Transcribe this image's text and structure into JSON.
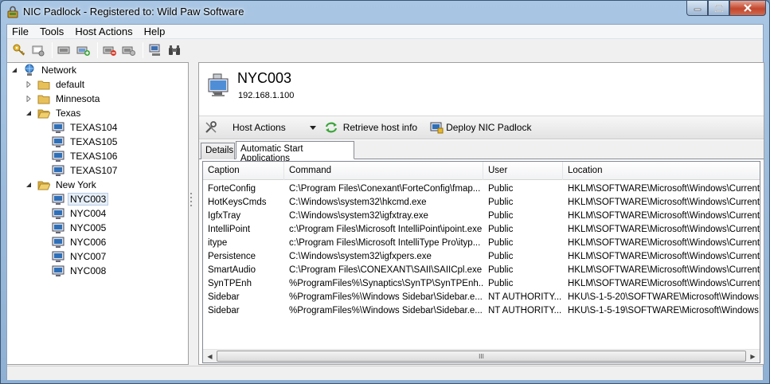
{
  "window": {
    "title": "NIC Padlock - Registered to: Wild Paw Software",
    "controls": [
      "minimize",
      "maximize",
      "close"
    ]
  },
  "menu": [
    "File",
    "Tools",
    "Host Actions",
    "Help"
  ],
  "toolbar": {
    "icons": [
      "key-icon",
      "host-properties-icon",
      "computer-remove-icon",
      "computer-add-icon",
      "computer-lock-icon",
      "computer-unlock-icon",
      "network-scan-icon",
      "binoculars-icon"
    ]
  },
  "tree": {
    "root": "Network",
    "groups": [
      {
        "label": "default",
        "expanded": false,
        "hosts": []
      },
      {
        "label": "Minnesota",
        "expanded": false,
        "hosts": []
      },
      {
        "label": "Texas",
        "expanded": true,
        "hosts": [
          "TEXAS104",
          "TEXAS105",
          "TEXAS106",
          "TEXAS107"
        ]
      },
      {
        "label": "New York",
        "expanded": true,
        "hosts": [
          "NYC003",
          "NYC004",
          "NYC005",
          "NYC006",
          "NYC007",
          "NYC008"
        ]
      }
    ],
    "selected": "NYC003"
  },
  "host": {
    "name": "NYC003",
    "ip": "192.168.1.100"
  },
  "actions": {
    "host_actions": "Host Actions",
    "retrieve": "Retrieve host info",
    "deploy": "Deploy NIC Padlock"
  },
  "tabs": [
    {
      "label": "Details",
      "active": false
    },
    {
      "label": "Automatic Start Applications",
      "active": true
    }
  ],
  "table": {
    "columns": [
      "Caption",
      "Command",
      "User",
      "Location"
    ],
    "rows": [
      [
        "ForteConfig",
        "C:\\Program Files\\Conexant\\ForteConfig\\fmap...",
        "Public",
        "HKLM\\SOFTWARE\\Microsoft\\Windows\\Current..."
      ],
      [
        "HotKeysCmds",
        "C:\\Windows\\system32\\hkcmd.exe",
        "Public",
        "HKLM\\SOFTWARE\\Microsoft\\Windows\\Current..."
      ],
      [
        "IgfxTray",
        "C:\\Windows\\system32\\igfxtray.exe",
        "Public",
        "HKLM\\SOFTWARE\\Microsoft\\Windows\\Current..."
      ],
      [
        "IntelliPoint",
        "c:\\Program Files\\Microsoft IntelliPoint\\ipoint.exe",
        "Public",
        "HKLM\\SOFTWARE\\Microsoft\\Windows\\Current..."
      ],
      [
        "itype",
        "c:\\Program Files\\Microsoft IntelliType Pro\\ityp...",
        "Public",
        "HKLM\\SOFTWARE\\Microsoft\\Windows\\Current..."
      ],
      [
        "Persistence",
        "C:\\Windows\\system32\\igfxpers.exe",
        "Public",
        "HKLM\\SOFTWARE\\Microsoft\\Windows\\Current..."
      ],
      [
        "SmartAudio",
        "C:\\Program Files\\CONEXANT\\SAII\\SAIICpl.exe /t",
        "Public",
        "HKLM\\SOFTWARE\\Microsoft\\Windows\\Current..."
      ],
      [
        "SynTPEnh",
        "%ProgramFiles%\\Synaptics\\SynTP\\SynTPEnh....",
        "Public",
        "HKLM\\SOFTWARE\\Microsoft\\Windows\\Current..."
      ],
      [
        "Sidebar",
        "%ProgramFiles%\\Windows Sidebar\\Sidebar.e...",
        "NT AUTHORITY...",
        "HKU\\S-1-5-20\\SOFTWARE\\Microsoft\\Windows..."
      ],
      [
        "Sidebar",
        "%ProgramFiles%\\Windows Sidebar\\Sidebar.e...",
        "NT AUTHORITY...",
        "HKU\\S-1-5-19\\SOFTWARE\\Microsoft\\Windows..."
      ]
    ]
  },
  "scrollbar": {
    "grip": "III"
  },
  "colors": {
    "selection": "#e5eef7",
    "folder": "#e8c05a",
    "monitor": "#2f6fb8"
  }
}
